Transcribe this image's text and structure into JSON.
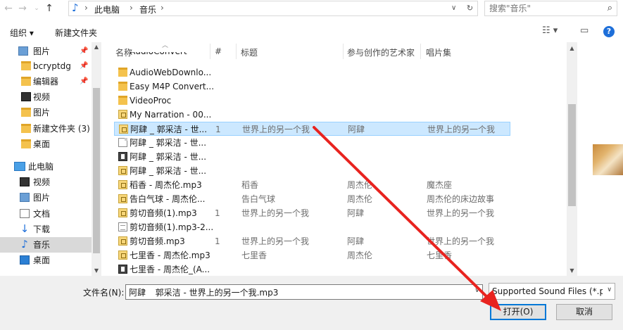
{
  "address": {
    "segments": [
      "此电脑",
      "音乐"
    ],
    "search_placeholder": "搜索\"音乐\""
  },
  "toolbar": {
    "organize": "组织 ▾",
    "new_folder": "新建文件夹"
  },
  "nav": {
    "items": [
      {
        "label": "图片"
      },
      {
        "label": "bcryptdg"
      },
      {
        "label": "编辑器"
      },
      {
        "label": "视频"
      },
      {
        "label": "图片"
      },
      {
        "label": "新建文件夹 (3)"
      },
      {
        "label": "桌面"
      },
      {
        "label": "此电脑"
      },
      {
        "label": "视频"
      },
      {
        "label": "图片"
      },
      {
        "label": "文档"
      },
      {
        "label": "下载"
      },
      {
        "label": "音乐"
      },
      {
        "label": "桌面"
      }
    ]
  },
  "columns": {
    "name": "名称",
    "num": "#",
    "title": "标题",
    "artist": "参与创作的艺术家",
    "album": "唱片集"
  },
  "files": [
    {
      "name": "AudioConvert",
      "num": "",
      "title": "",
      "artist": "",
      "album": ""
    },
    {
      "name": "AudioWebDownlo...",
      "num": "",
      "title": "",
      "artist": "",
      "album": ""
    },
    {
      "name": "Easy M4P Convert...",
      "num": "",
      "title": "",
      "artist": "",
      "album": ""
    },
    {
      "name": "VideoProc",
      "num": "",
      "title": "",
      "artist": "",
      "album": ""
    },
    {
      "name": "My Narration - 00...",
      "num": "",
      "title": "",
      "artist": "",
      "album": ""
    },
    {
      "name": "阿肆 _ 郭采洁 - 世...",
      "num": "1",
      "title": "世界上的另一个我",
      "artist": "阿肆",
      "album": "世界上的另一个我"
    },
    {
      "name": "阿肆 _ 郭采洁 - 世...",
      "num": "",
      "title": "",
      "artist": "",
      "album": ""
    },
    {
      "name": "阿肆 _ 郭采洁 - 世...",
      "num": "",
      "title": "",
      "artist": "",
      "album": ""
    },
    {
      "name": "阿肆 _ 郭采洁 - 世...",
      "num": "",
      "title": "",
      "artist": "",
      "album": ""
    },
    {
      "name": "稻香 - 周杰伦.mp3",
      "num": "",
      "title": "稻香",
      "artist": "周杰伦",
      "album": "魔杰座"
    },
    {
      "name": "告白气球 - 周杰伦...",
      "num": "",
      "title": "告白气球",
      "artist": "周杰伦",
      "album": "周杰伦的床边故事"
    },
    {
      "name": "剪切音频(1).mp3",
      "num": "1",
      "title": "世界上的另一个我",
      "artist": "阿肆",
      "album": "世界上的另一个我"
    },
    {
      "name": "剪切音频(1).mp3-2...",
      "num": "",
      "title": "",
      "artist": "",
      "album": ""
    },
    {
      "name": "剪切音频.mp3",
      "num": "1",
      "title": "世界上的另一个我",
      "artist": "阿肆",
      "album": "世界上的另一个我"
    },
    {
      "name": "七里香 - 周杰伦.mp3",
      "num": "",
      "title": "七里香",
      "artist": "周杰伦",
      "album": "七里香"
    },
    {
      "name": "七里香 - 周杰伦_(A...",
      "num": "",
      "title": "",
      "artist": "",
      "album": ""
    }
  ],
  "bottom": {
    "filename_label": "文件名(N):",
    "filename_value": "阿肆 _ 郭采洁 - 世界上的另一个我.mp3",
    "filetype": "Supported Sound Files (*.pcm",
    "open": "打开(O)",
    "cancel": "取消"
  },
  "colors": {
    "selection": "#cce8ff",
    "accent": "#0078d7",
    "annotation": "#e8231f"
  }
}
